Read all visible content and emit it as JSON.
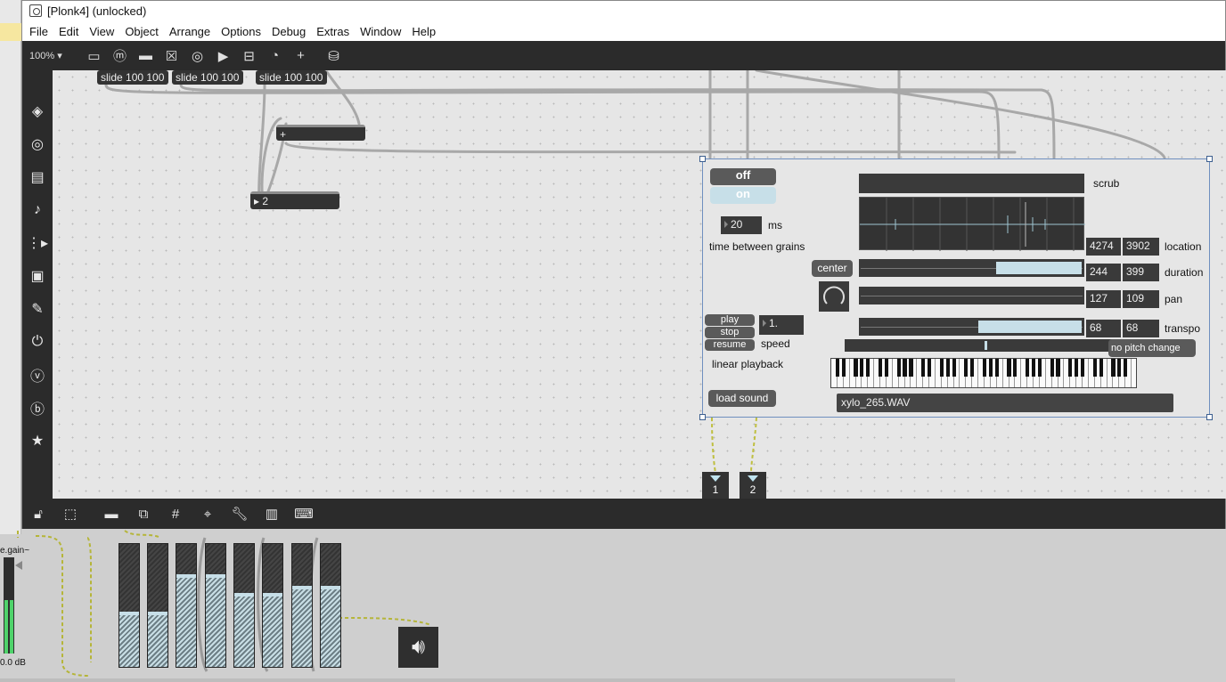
{
  "window": {
    "title": "[Plonk4] (unlocked)"
  },
  "menu": [
    "File",
    "Edit",
    "View",
    "Object",
    "Arrange",
    "Options",
    "Debug",
    "Extras",
    "Window",
    "Help"
  ],
  "toolbar": {
    "zoom": "100%",
    "icons": [
      "presentation-icon",
      "message-icon",
      "comment-icon",
      "button-icon",
      "toggle-icon",
      "number-icon",
      "slider-icon",
      "dial-icon",
      "add-icon",
      "paint-bucket-icon"
    ]
  },
  "leftbar": {
    "icons": [
      "packages-icon",
      "target-icon",
      "media-icon",
      "music-note-icon",
      "sequencer-icon",
      "image-icon",
      "paperclip-icon",
      "plug-icon",
      "vizzie-icon",
      "beap-icon",
      "favorites-icon"
    ]
  },
  "bottombar": {
    "icons": [
      "lock-icon",
      "presentation-mode-icon",
      "comment-icon",
      "layers-icon",
      "grid-icon",
      "snap-icon",
      "wrench-icon",
      "piano-icon",
      "keyboard-icon"
    ]
  },
  "patch": {
    "slide1": "slide 100 100",
    "slide2": "slide 100 100",
    "slide3": "slide 100 100",
    "plus": "+",
    "div": "2"
  },
  "bpatcher": {
    "off": "off",
    "on": "on",
    "grain_ms": "20",
    "ms_label": "ms",
    "time_between_grains": "time between grains",
    "scrub": "scrub",
    "location": {
      "label": "location",
      "a": "4274",
      "b": "3902"
    },
    "duration": {
      "label": "duration",
      "a": "244",
      "b": "399",
      "level": 0.39
    },
    "pan": {
      "label": "pan",
      "a": "127",
      "b": "109"
    },
    "transpo": {
      "label": "transpo",
      "a": "68",
      "b": "68",
      "level": 0.47
    },
    "center": "center",
    "play": "play",
    "stop": "stop",
    "resume": "resume",
    "speed_value": "1.",
    "speed_label": "speed",
    "linear_playback": "linear playback",
    "no_pitch_change": "no pitch change",
    "load_sound": "load sound",
    "filename": "xylo_265.WAV"
  },
  "outlets": [
    "1",
    "2"
  ],
  "mixer": {
    "gain_label": "e.gain~",
    "db_label": "0.0 dB",
    "fader_levels": [
      0.44,
      0.44,
      0.74,
      0.74,
      0.59,
      0.59,
      0.65,
      0.65
    ]
  },
  "colors": {
    "dark_ui": "#2b2b2b",
    "light_accent": "#c7dfe8",
    "canvas": "#e6e6e6"
  }
}
